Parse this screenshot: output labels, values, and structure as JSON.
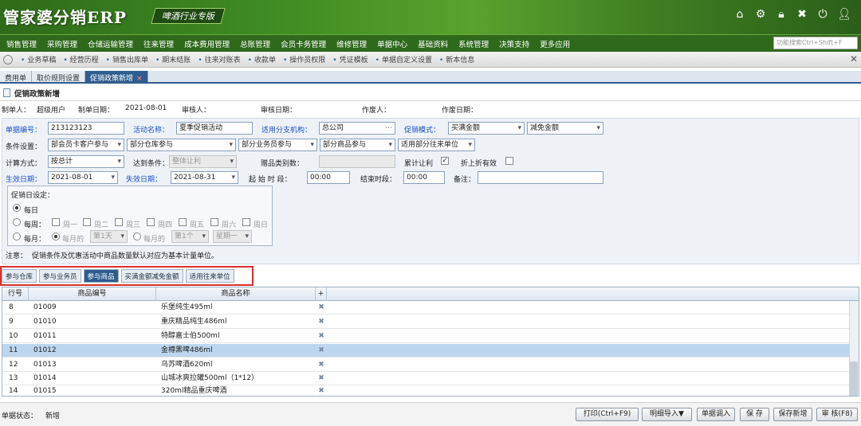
{
  "app": {
    "logo_text": "管家婆分销ERP",
    "edition": "啤酒行业专版"
  },
  "menu": {
    "items": [
      "销售管理",
      "采购管理",
      "仓储运输管理",
      "往来管理",
      "成本费用管理",
      "总账管理",
      "会员卡务管理",
      "维修管理",
      "单据中心",
      "基础资料",
      "系统管理",
      "决策支持",
      "更多应用"
    ],
    "search_placeholder": "功能搜索Ctrl+Shift+F"
  },
  "shortcuts": [
    "业务草稿",
    "经营历程",
    "销售出库单",
    "期末结账",
    "往来对账表",
    "收款单",
    "操作员权限",
    "凭证模板",
    "单据自定义设置",
    "新本信息"
  ],
  "doc_tabs": [
    {
      "label": "费用单"
    },
    {
      "label": "取价规则设置"
    },
    {
      "label": "促销政策新增",
      "close": "×"
    }
  ],
  "page": {
    "title": "促销政策新增"
  },
  "meta": {
    "maker_label": "制单人：",
    "maker_value": "超级用户",
    "date_label": "制单日期：",
    "date_value": "2021-08-01",
    "auditor_label": "审核人：",
    "audit_date_label": "审核日期：",
    "voider_label": "作废人：",
    "void_date_label": "作废日期："
  },
  "form": {
    "bill_no_label": "单据编号：",
    "bill_no": "213123123",
    "activity_label": "活动名称：",
    "activity": "夏季促销活动",
    "branch_label": "适用分支机构：",
    "branch": "总公司",
    "mode_label": "促销模式：",
    "mode1": "买满金额",
    "mode2": "减免金额",
    "cond_label": "条件设置：",
    "cond1": "部会员卡客户参与",
    "cond2": "部分仓库参与",
    "cond3": "部分业务员参与",
    "cond4": "部分商品参与",
    "cond5": "适用部分往来单位",
    "calc_label": "计算方式：",
    "calc": "按总计",
    "reach_label": "达到条件：",
    "reach": "整体让利",
    "gift_label": "赠品类别数：",
    "cumulative_label": "累计让利",
    "cumulative_check": "✓",
    "discount_label": "折上折有效",
    "eff_date_label": "生效日期：",
    "eff_date": "2021-08-01",
    "exp_date_label": "失效日期：",
    "exp_date": "2021-08-31",
    "start_time_label": "起 始 时 段：",
    "start_time": "00:00",
    "end_time_label": "结束时段：",
    "end_time": "00:00",
    "remark_label": "备注："
  },
  "schedule": {
    "title": "促销日设定：",
    "daily": "每日",
    "weekly": "每周：",
    "weekdays": [
      "周一",
      "周二",
      "周三",
      "周四",
      "周五",
      "周六",
      "周日"
    ],
    "monthly": "每月：",
    "monthly_opt1": "每月的",
    "monthly_day": "第1天",
    "monthly_opt2": "每月的",
    "monthly_week": "第1个",
    "monthly_weekday": "星期一"
  },
  "note": {
    "label": "注意：",
    "text": "促销条件及优惠活动中商品数量默认对应为基本计量单位。"
  },
  "bottom_tabs": [
    "参与仓库",
    "参与业务员",
    "参与商品",
    "买满金额减免金额",
    "适用往来单位"
  ],
  "grid": {
    "headers": {
      "row": "行号",
      "code": "商品编号",
      "name": "商品名称",
      "add": "+"
    },
    "rows": [
      {
        "row": "8",
        "code": "01009",
        "name": "乐堡纯生495ml"
      },
      {
        "row": "9",
        "code": "01010",
        "name": "重庆精品纯生486ml"
      },
      {
        "row": "10",
        "code": "01011",
        "name": "特醇嘉士伯500ml"
      },
      {
        "row": "11",
        "code": "01012",
        "name": "金樽黑啤486ml"
      },
      {
        "row": "12",
        "code": "01013",
        "name": "乌苏啤酒620ml"
      },
      {
        "row": "13",
        "code": "01014",
        "name": "山城冰爽拉罐500ml（1*12）"
      },
      {
        "row": "14",
        "code": "01015",
        "name": "320ml精品重庆啤酒"
      }
    ],
    "del_icon": "✖"
  },
  "status": {
    "label": "单据状态：",
    "value": "新增"
  },
  "buttons": {
    "print": "打印(Ctrl+F9)",
    "detail_import": "明细导入▼",
    "bill_import": "单据调入",
    "save": "保 存",
    "save_new": "保存新增",
    "audit": "审 核(F8)"
  }
}
